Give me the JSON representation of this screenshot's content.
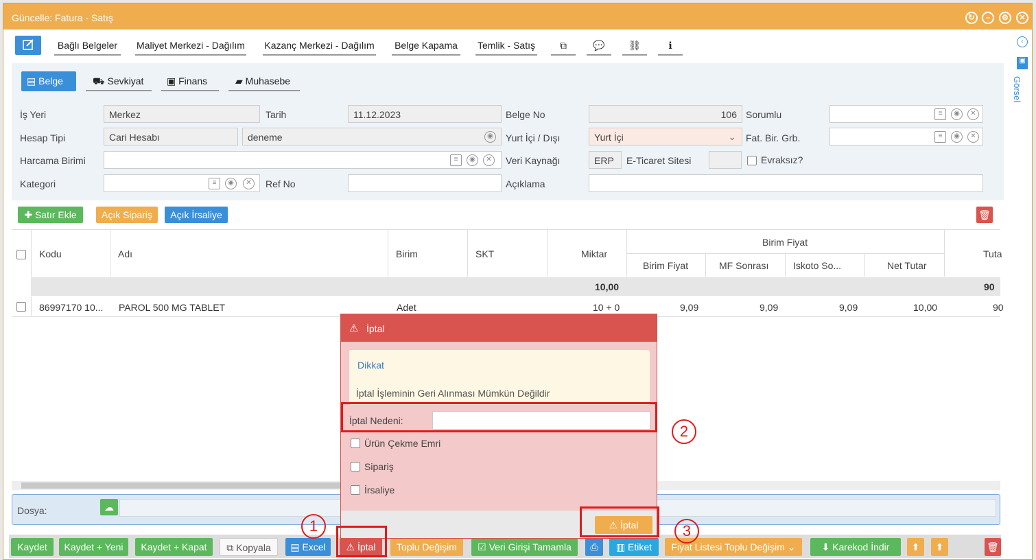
{
  "window": {
    "title": "Güncelle: Fatura - Satış"
  },
  "toolbar": {
    "links": [
      "Bağlı Belgeler",
      "Maliyet Merkezi - Dağılım",
      "Kazanç Merkezi - Dağılım",
      "Belge Kapama",
      "Temlik - Satış"
    ]
  },
  "tabs": [
    {
      "label": "Belge",
      "icon": "document-icon"
    },
    {
      "label": "Sevkiyat",
      "icon": "truck-icon"
    },
    {
      "label": "Finans",
      "icon": "money-icon"
    },
    {
      "label": "Muhasebe",
      "icon": "book-icon"
    }
  ],
  "form": {
    "is_yeri": {
      "label": "İş Yeri",
      "value": "Merkez"
    },
    "tarih": {
      "label": "Tarih",
      "value": "11.12.2023"
    },
    "belge_no": {
      "label": "Belge No",
      "value": "106"
    },
    "sorumlu": {
      "label": "Sorumlu",
      "value": ""
    },
    "hesap_tipi": {
      "label": "Hesap Tipi",
      "value": "Cari Hesabı",
      "value2": "deneme"
    },
    "yurt": {
      "label": "Yurt İçi / Dışı",
      "value": "Yurt İçi"
    },
    "fat_bir": {
      "label": "Fat. Bir. Grb.",
      "value": ""
    },
    "harcama": {
      "label": "Harcama Birimi",
      "value": ""
    },
    "veri_kaynagi": {
      "label": "Veri Kaynağı",
      "value": "ERP"
    },
    "eticaret": {
      "label": "E-Ticaret Sitesi",
      "value": ""
    },
    "evraksiz": {
      "label": "Evraksız?"
    },
    "kategori": {
      "label": "Kategori",
      "value": ""
    },
    "ref_no": {
      "label": "Ref No",
      "value": ""
    },
    "aciklama": {
      "label": "Açıklama",
      "value": ""
    }
  },
  "actions": {
    "satir_ekle": "Satır Ekle",
    "acik_siparis": "Açık Sipariş",
    "acik_irsaliye": "Açık İrsaliye"
  },
  "grid": {
    "headers": {
      "kodu": "Kodu",
      "adi": "Adı",
      "birim": "Birim",
      "skt": "SKT",
      "miktar": "Miktar",
      "birim_fiyat_group": "Birim Fiyat",
      "birim_fiyat": "Birim Fiyat",
      "mf_sonrasi": "MF Sonrası",
      "iskoto": "Iskoto So...",
      "net_tutar": "Net Tutar",
      "tutar": "Tuta"
    },
    "total": {
      "miktar": "10,00",
      "tutar": "90"
    },
    "rows": [
      {
        "kodu": "86997170 10...",
        "adi": "PAROL 500 MG TABLET",
        "birim": "Adet",
        "skt": "",
        "miktar": "10 + 0",
        "birim_fiyat": "9,09",
        "mf_sonrasi": "9,09",
        "iskoto": "9,09",
        "net_tutar": "10,00",
        "tutar": "90"
      }
    ]
  },
  "dosya": {
    "label": "Dosya:"
  },
  "dialog": {
    "title": "İptal",
    "warn_title": "Dikkat",
    "warn_text": "İptal İşleminin Geri Alınması Mümkün Değildir",
    "reason_label": "İptal Nedeni:",
    "reason_value": "",
    "options": [
      "Ürün Çekme Emri",
      "Sipariş",
      "İrsaliye"
    ],
    "confirm": "İptal"
  },
  "annotations": [
    "1",
    "2",
    "3"
  ],
  "bottom": {
    "kaydet": "Kaydet",
    "kaydet_yeni": "Kaydet + Yeni",
    "kaydet_kapat": "Kaydet + Kapat",
    "kopyala": "Kopyala",
    "excel": "Excel",
    "iptal": "İptal",
    "toplu": "Toplu Değişim",
    "veri": "Veri Girişi Tamamla",
    "etiket": "Etiket",
    "fiyat": "Fiyat Listesi Toplu Değişim",
    "karekod": "Karekod İndir"
  },
  "right_panel": {
    "label": "Görsel"
  }
}
